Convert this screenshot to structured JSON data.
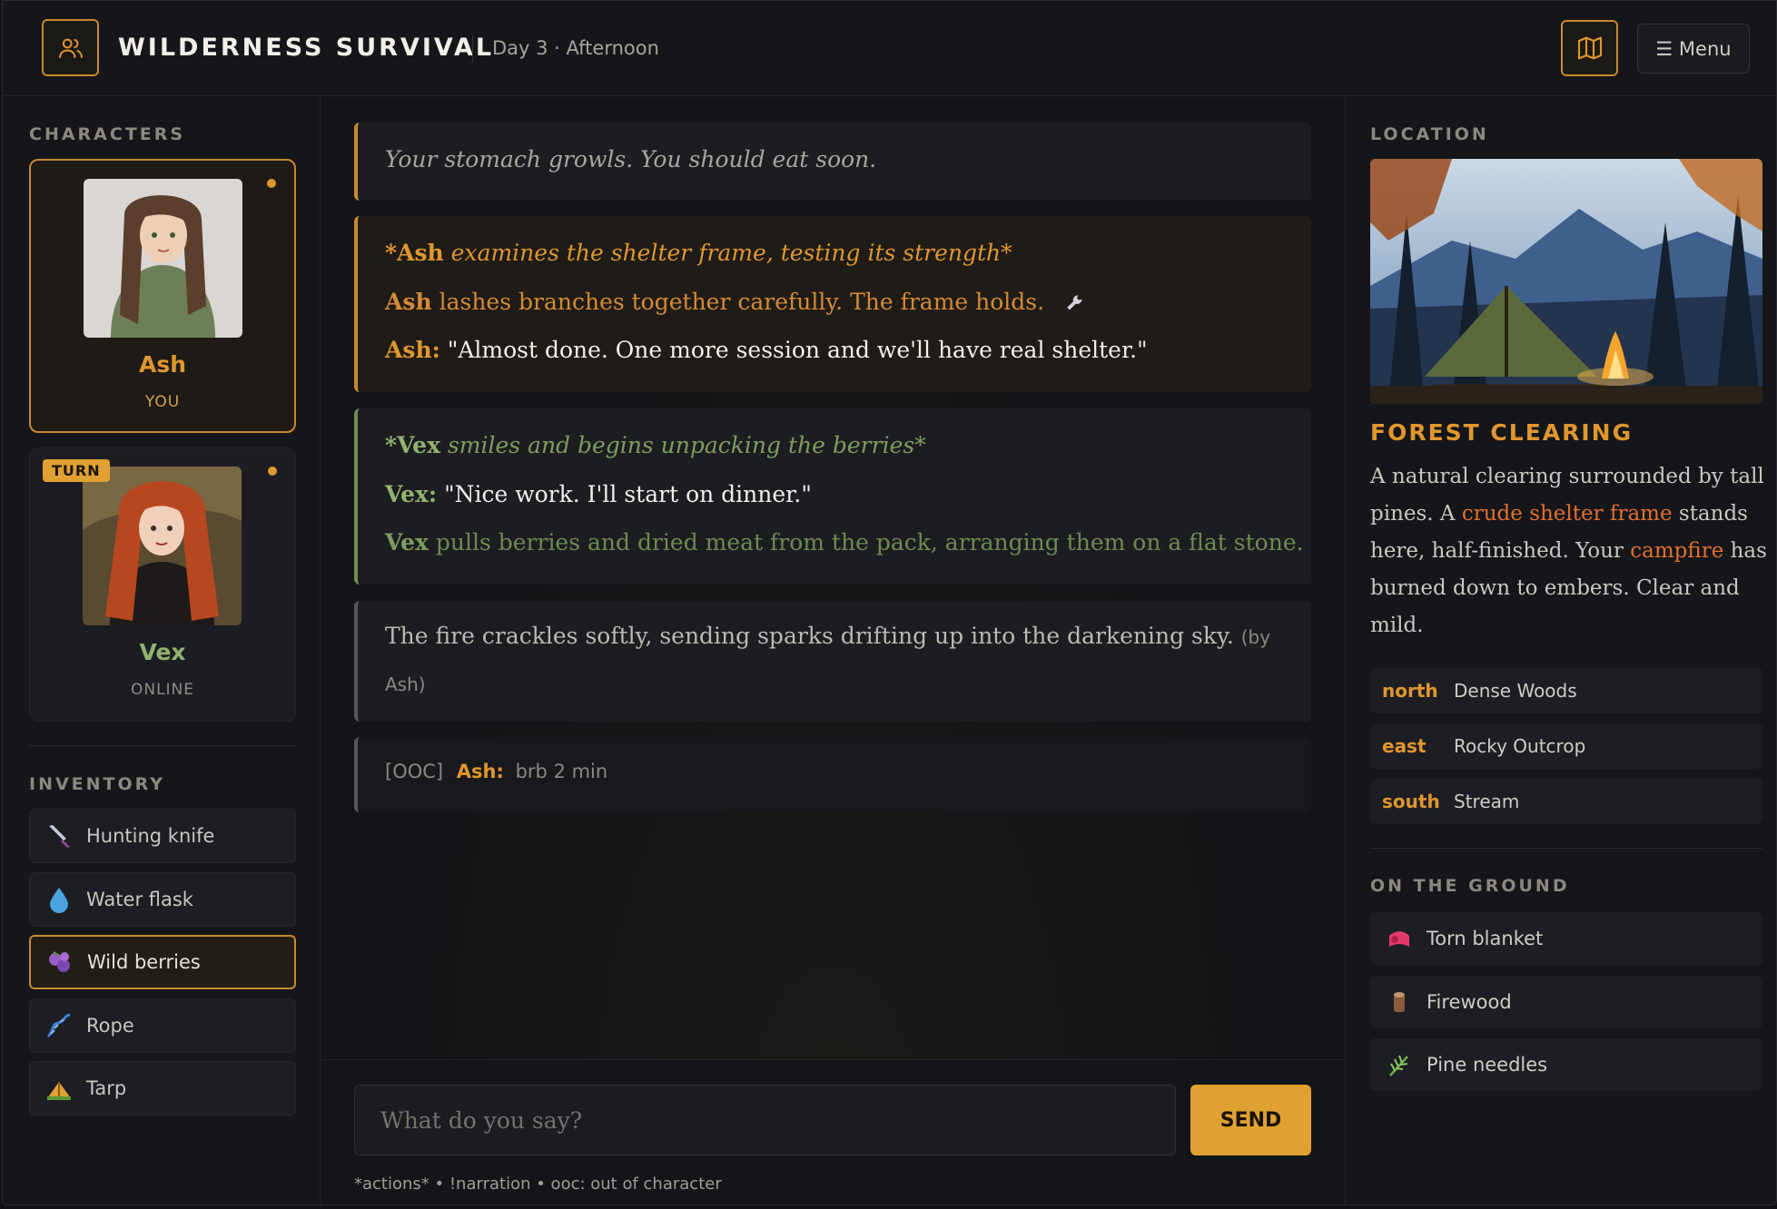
{
  "header": {
    "title": "WILDERNESS SURVIVAL",
    "day": "Day 3 · Afternoon",
    "menu_label": "☰ Menu",
    "accent": "#c7892d"
  },
  "characters": {
    "label": "CHARACTERS",
    "list": [
      {
        "name": "Ash",
        "status": "YOU",
        "name_color": "#e0962e",
        "active": true
      },
      {
        "name": "Vex",
        "status": "ONLINE",
        "name_color": "#93b26f",
        "badge": "TURN"
      }
    ]
  },
  "inventory": {
    "label": "INVENTORY",
    "items": [
      {
        "label": "Hunting knife",
        "icon": "knife-icon"
      },
      {
        "label": "Water flask",
        "icon": "droplet-icon"
      },
      {
        "label": "Wild berries",
        "icon": "berries-icon",
        "selected": true
      },
      {
        "label": "Rope",
        "icon": "rope-icon"
      },
      {
        "label": "Tarp",
        "icon": "tarp-icon"
      }
    ]
  },
  "messages": {
    "m1": {
      "text": "Your stomach growls. You should eat soon."
    },
    "m2": {
      "l1_name": "*Ash",
      "l1_text": " examines the shelter frame, testing its strength*",
      "l2_name": "Ash",
      "l2_text": " lashes branches together carefully. The frame holds.",
      "l3_name": "Ash:",
      "l3_text": " \"Almost done. One more session and we'll have real shelter.\""
    },
    "m3": {
      "l1_name": "*Vex",
      "l1_text": " smiles and begins unpacking the berries*",
      "l2_name": "Vex:",
      "l2_text": " \"Nice work. I'll start on dinner.\"",
      "l3_name": "Vex",
      "l3_text": " pulls berries and dried meat from the pack, arranging them on a flat stone."
    },
    "m4": {
      "text": "The fire crackles softly, sending sparks drifting up into the darkening sky.",
      "by_a": "(by",
      "by_b": "Ash)"
    },
    "m5": {
      "tag": "[OOC]",
      "name": "Ash:",
      "text": "brb 2 min"
    }
  },
  "composer": {
    "placeholder": "What do you say?",
    "send": "SEND",
    "hint": "*actions* • !narration • ooc: out of character"
  },
  "location": {
    "label": "LOCATION",
    "name": "FOREST CLEARING",
    "desc_1": "A natural clearing surrounded by tall pines. A ",
    "desc_hl1": "crude shelter frame",
    "desc_2": " stands here, half-finished. Your ",
    "desc_hl2": "campfire",
    "desc_3": " has burned down to embers. Clear and mild.",
    "exits": [
      {
        "dir": "north",
        "name": "Dense Woods"
      },
      {
        "dir": "east",
        "name": "Rocky Outcrop"
      },
      {
        "dir": "south",
        "name": "Stream"
      }
    ]
  },
  "ground": {
    "label": "ON THE GROUND",
    "items": [
      {
        "label": "Torn blanket",
        "icon": "blanket-icon"
      },
      {
        "label": "Firewood",
        "icon": "log-icon"
      },
      {
        "label": "Pine needles",
        "icon": "leaf-icon"
      }
    ]
  }
}
